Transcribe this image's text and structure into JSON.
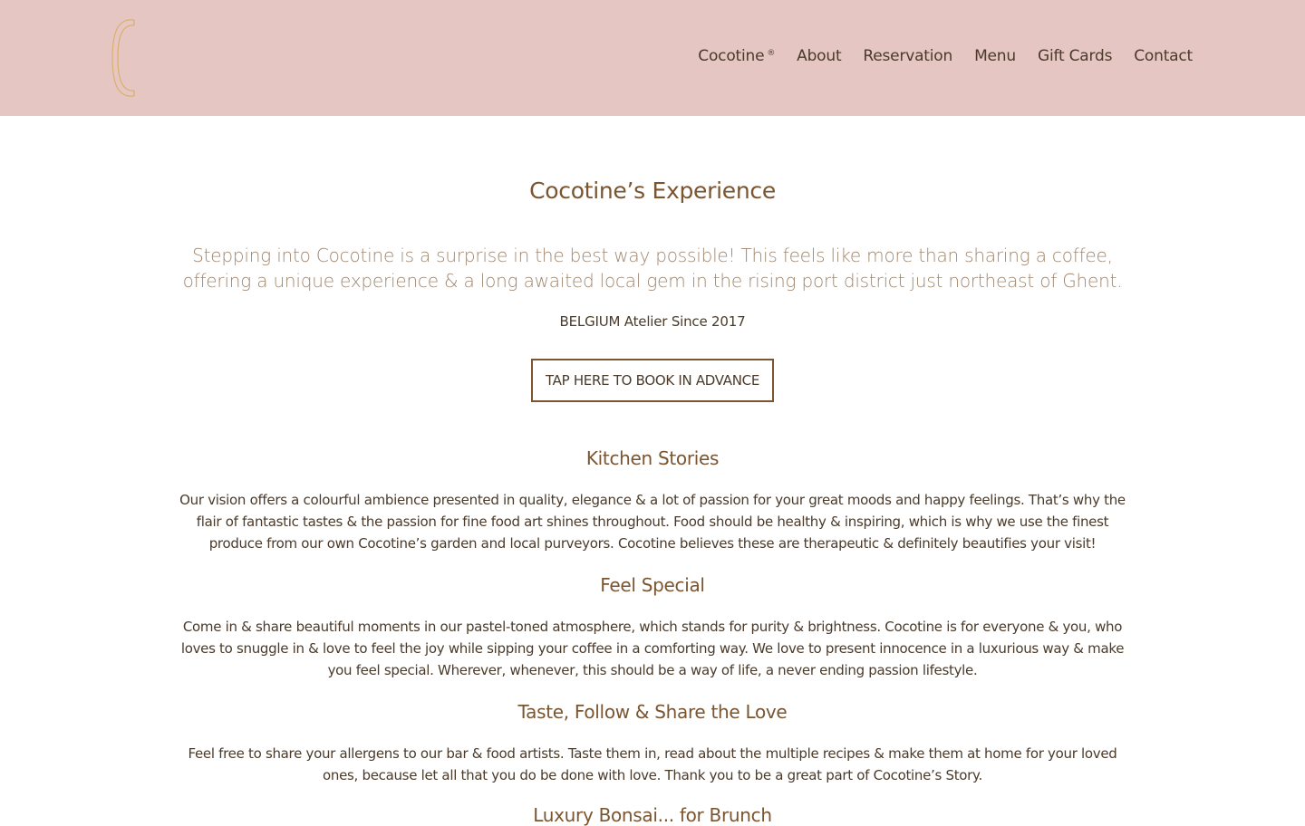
{
  "header": {
    "logo_icon": "c-monogram-logo",
    "nav": [
      {
        "label": "Cocotine",
        "mark": "®"
      },
      {
        "label": "About"
      },
      {
        "label": "Reservation"
      },
      {
        "label": "Menu"
      },
      {
        "label": "Gift Cards"
      },
      {
        "label": "Contact"
      }
    ]
  },
  "main": {
    "title": "Cocotine’s Experience",
    "intro": "Stepping into Cocotine is a surprise in the best way possible! This feels like more than sharing a coffee, offering a unique experience & a long awaited local gem in the rising port district just northeast of Ghent.",
    "tagline": "BELGIUM Atelier Since 2017",
    "book_button": "TAP HERE TO BOOK IN ADVANCE",
    "sections": [
      {
        "title": "Kitchen Stories",
        "text": "Our vision offers a colourful ambience presented in quality, elegance & a lot of passion for your great moods and happy feelings. That’s why the flair of fantastic tastes & the passion for fine food art shines throughout. Food should be healthy & inspiring, which is why we use the finest produce from our own Cocotine’s garden and local purveyors. Cocotine believes these are therapeutic & definitely beautifies your visit!"
      },
      {
        "title": "Feel Special",
        "text": "Come in & share beautiful moments in our pastel-toned atmosphere, which stands for purity & brightness. Cocotine is for everyone & you, who loves to snuggle in & love to feel the joy while sipping your coffee in a comforting way. We love to present innocence in a luxurious way & make you feel special. Wherever, whenever, this should be a way of life, a never ending passion lifestyle."
      },
      {
        "title": "Taste, Follow & Share the Love",
        "text": "Feel free to share your allergens to our bar & food artists. Taste them in, read about the multiple recipes & make them at home for your loved ones, because let all that you do be done with love. Thank you to be a great part of Cocotine’s Story."
      },
      {
        "title": "Luxury Bonsai... for Brunch"
      }
    ]
  },
  "colors": {
    "header_bg": "#e5c6c2",
    "heading": "#7a5530",
    "body_text": "#4a3a2a",
    "intro_text": "#a08770",
    "logo_gold": "#d8b06a"
  }
}
